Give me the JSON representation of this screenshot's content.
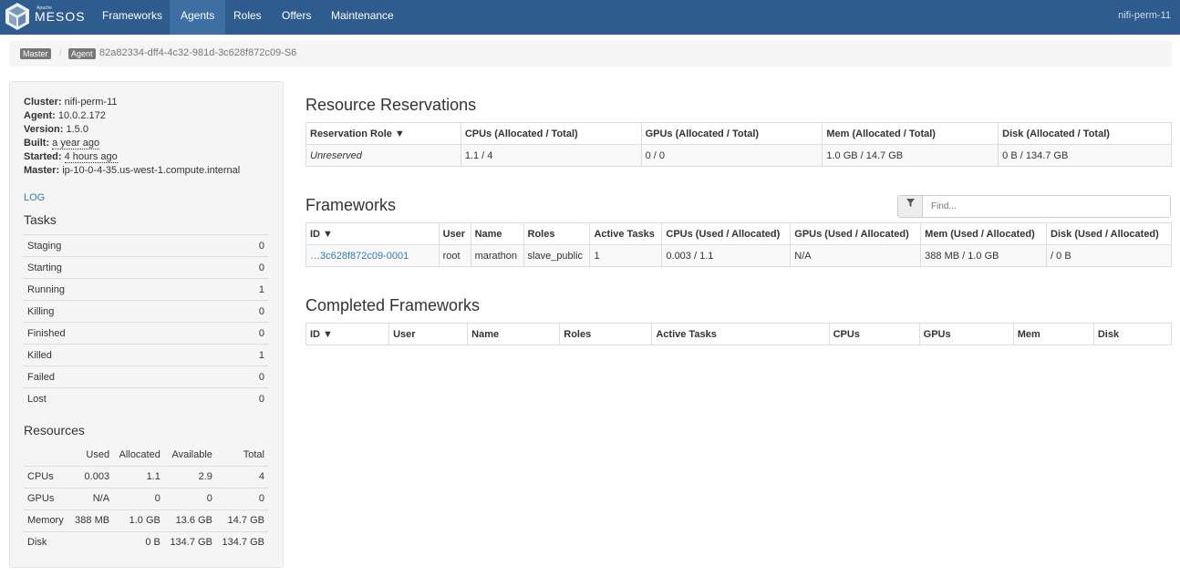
{
  "navbar": {
    "brand_small": "Apache",
    "brand_name": "MESOS",
    "items": [
      "Frameworks",
      "Agents",
      "Roles",
      "Offers",
      "Maintenance"
    ],
    "active": "Agents",
    "cluster_name": "nifi-perm-11"
  },
  "breadcrumb": {
    "master_label": "Master",
    "agent_label": "Agent",
    "sep": "/",
    "agent_id": "82a82334-dff4-4c32-981d-3c628f872c09-S6"
  },
  "sidebar": {
    "info": [
      {
        "label": "Cluster:",
        "value": "nifi-perm-11"
      },
      {
        "label": "Agent:",
        "value": "10.0.2.172"
      },
      {
        "label": "Version:",
        "value": "1.5.0"
      },
      {
        "label": "Built:",
        "value": "a year ago"
      },
      {
        "label": "Started:",
        "value": "4 hours ago"
      },
      {
        "label": "Master:",
        "value": "ip-10-0-4-35.us-west-1.compute.internal"
      }
    ],
    "log": "LOG",
    "tasks_title": "Tasks",
    "tasks": [
      {
        "name": "Staging",
        "count": "0"
      },
      {
        "name": "Starting",
        "count": "0"
      },
      {
        "name": "Running",
        "count": "1"
      },
      {
        "name": "Killing",
        "count": "0"
      },
      {
        "name": "Finished",
        "count": "0"
      },
      {
        "name": "Killed",
        "count": "1"
      },
      {
        "name": "Failed",
        "count": "0"
      },
      {
        "name": "Lost",
        "count": "0"
      }
    ],
    "resources_title": "Resources",
    "resource_headers": [
      "",
      "Used",
      "Allocated",
      "Available",
      "Total"
    ],
    "resources": [
      [
        "CPUs",
        "0.003",
        "1.1",
        "2.9",
        "4"
      ],
      [
        "GPUs",
        "N/A",
        "0",
        "0",
        "0"
      ],
      [
        "Memory",
        "388 MB",
        "1.0 GB",
        "13.6 GB",
        "14.7 GB"
      ],
      [
        "Disk",
        "",
        "0 B",
        "134.7 GB",
        "134.7 GB"
      ]
    ]
  },
  "reservations": {
    "title": "Resource Reservations",
    "headers": [
      "Reservation Role ▼",
      "CPUs (Allocated / Total)",
      "GPUs (Allocated / Total)",
      "Mem (Allocated / Total)",
      "Disk (Allocated / Total)"
    ],
    "rows": [
      [
        "Unreserved",
        "1.1 / 4",
        "0 / 0",
        "1.0 GB / 14.7 GB",
        "0 B / 134.7 GB"
      ]
    ]
  },
  "frameworks": {
    "title": "Frameworks",
    "find_placeholder": "Find...",
    "headers": [
      "ID ▼",
      "User",
      "Name",
      "Roles",
      "Active Tasks",
      "CPUs (Used / Allocated)",
      "GPUs (Used / Allocated)",
      "Mem (Used / Allocated)",
      "Disk (Used / Allocated)"
    ],
    "rows": [
      [
        "…3c628f872c09-0001",
        "root",
        "marathon",
        "slave_public",
        "1",
        "0.003 / 1.1",
        "N/A",
        "388 MB / 1.0 GB",
        "/ 0 B"
      ]
    ]
  },
  "completed": {
    "title": "Completed Frameworks",
    "headers": [
      "ID ▼",
      "User",
      "Name",
      "Roles",
      "Active Tasks",
      "CPUs",
      "GPUs",
      "Mem",
      "Disk"
    ]
  }
}
